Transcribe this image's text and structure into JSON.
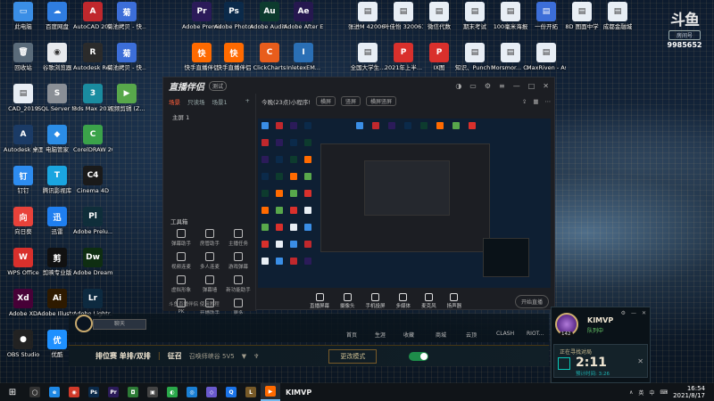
{
  "douyu": {
    "logo": "斗鱼",
    "room_label": "房间号",
    "room_number": "9985652"
  },
  "desktop_icons": [
    {
      "label": "此电脑",
      "color": "#3a8ee6",
      "glyph": "▭"
    },
    {
      "label": "百度网盘",
      "color": "#2f7de1",
      "glyph": "☁"
    },
    {
      "label": "AutoCAD 2019 - 简...",
      "color": "#c0282d",
      "glyph": "A"
    },
    {
      "label": "菊池拷贝 - 快...",
      "color": "#3c6ed8",
      "glyph": "菊"
    },
    {
      "label": "Adobe Premie...",
      "color": "#2b1b59",
      "glyph": "Pr"
    },
    {
      "label": "Adobe Photosh...",
      "color": "#0b2a4a",
      "glyph": "Ps"
    },
    {
      "label": "Adobe Auditi...",
      "color": "#0d3b2e",
      "glyph": "Au"
    },
    {
      "label": "Adobe After Effects CC",
      "color": "#26184f",
      "glyph": "Ae"
    },
    {
      "label": "回收站",
      "color": "#5a6b7a",
      "glyph": "🗑"
    },
    {
      "label": "谷歌浏览器",
      "color": "#e8eaed",
      "glyph": "◉"
    },
    {
      "label": "Autodesk ReCap",
      "color": "#2b2b2b",
      "glyph": "R"
    },
    {
      "label": "菊池拷贝 - 快...",
      "color": "#3c6ed8",
      "glyph": "菊"
    },
    {
      "label": "快手直播伴侣",
      "color": "#ff6a00",
      "glyph": "快"
    },
    {
      "label": "快手直播伴侣",
      "color": "#ff6a00",
      "glyph": "快"
    },
    {
      "label": "ClickCharts",
      "color": "#e85d1c",
      "glyph": "C"
    },
    {
      "label": "InletexEM...",
      "color": "#2a6fb5",
      "glyph": "I"
    },
    {
      "label": "CAD_2019",
      "color": "#e8eef5",
      "glyph": "▤"
    },
    {
      "label": "SQL Server Managem...",
      "color": "#8a8f96",
      "glyph": "S"
    },
    {
      "label": "3ds Max 2019",
      "color": "#1a8ca0",
      "glyph": "3"
    },
    {
      "label": "视频剪辑 (Z...",
      "color": "#58a84b",
      "glyph": "▶"
    },
    {
      "label": "Autodesk 桌面应用程序",
      "color": "#1b3b66",
      "glyph": "A"
    },
    {
      "label": "电脑管家",
      "color": "#2b8de6",
      "glyph": "◆"
    },
    {
      "label": "CorelDRAW 2020 (64-...",
      "color": "#3ba34a",
      "glyph": "C"
    },
    {
      "label": "钉钉",
      "color": "#2d8cf0",
      "glyph": "钉"
    },
    {
      "label": "腾讯影视库",
      "color": "#1aa5e0",
      "glyph": "T"
    },
    {
      "label": "Cinema 4D",
      "color": "#1a1a1a",
      "glyph": "C4"
    },
    {
      "label": "向日葵",
      "color": "#e9423a",
      "glyph": "向"
    },
    {
      "label": "迅雷",
      "color": "#1f7ff0",
      "glyph": "迅"
    },
    {
      "label": "Adobe Prelu...",
      "color": "#0f2e3a",
      "glyph": "Pl"
    },
    {
      "label": "WPS Office",
      "color": "#d9302c",
      "glyph": "W"
    },
    {
      "label": "剪映专业版",
      "color": "#111111",
      "glyph": "剪"
    },
    {
      "label": "Adobe Dreamwe...",
      "color": "#0f2e12",
      "glyph": "Dw"
    },
    {
      "label": "Adobe XD",
      "color": "#470137",
      "glyph": "Xd"
    },
    {
      "label": "Adobe Illustr...",
      "color": "#2e1a00",
      "glyph": "Ai"
    },
    {
      "label": "Adobe Lightr...",
      "color": "#0d2a40",
      "glyph": "Lr"
    },
    {
      "label": "OBS Studio",
      "color": "#222222",
      "glyph": "●"
    },
    {
      "label": "优酷",
      "color": "#1e90ff",
      "glyph": "优"
    },
    {
      "label": "张进M 42006017",
      "color": "#e8eef5",
      "glyph": "▤"
    },
    {
      "label": "叶佳怡 32006122",
      "color": "#e8eef5",
      "glyph": "▤"
    },
    {
      "label": "微信代数",
      "color": "#e8eef5",
      "glyph": "▤"
    },
    {
      "label": "期末考试",
      "color": "#e8eef5",
      "glyph": "▤"
    },
    {
      "label": "100毫米海报",
      "color": "#e8eef5",
      "glyph": "▤"
    },
    {
      "label": "一份开拓",
      "color": "#3c6ed8",
      "glyph": "▤"
    },
    {
      "label": "8D 图面中学",
      "color": "#e8eef5",
      "glyph": "▤"
    },
    {
      "label": "成都金融城",
      "color": "#e8eef5",
      "glyph": "▤"
    },
    {
      "label": "全国大学生...",
      "color": "#e8eef5",
      "glyph": "▤"
    },
    {
      "label": "2021年上半...",
      "color": "#d9302c",
      "glyph": "P"
    },
    {
      "label": "IX图",
      "color": "#d9302c",
      "glyph": "P"
    },
    {
      "label": "知识、Punch Home ...",
      "color": "#e8eef5",
      "glyph": "▤"
    },
    {
      "label": "Morsmor... Crazy D...",
      "color": "#e8eef5",
      "glyph": "▤"
    },
    {
      "label": "MaxRiven - Astronomi...",
      "color": "#e8eef5",
      "glyph": "▤"
    }
  ],
  "streaming_app": {
    "brand": "直播伴侣",
    "version": "测试",
    "scene_tabs": [
      "场景",
      "只读场",
      "场景1"
    ],
    "scene_item": "主屏 1",
    "toolbox_title": "工具箱",
    "tools": [
      "弹幕助手",
      "房管助手",
      "主播任务",
      "视频连麦",
      "多人连麦",
      "游戏弹幕",
      "虚拟形象",
      "弹幕墙",
      "新功能助手",
      "PK",
      "开播助手",
      "更多"
    ],
    "sidebar_footer": "斗鱼直播伴侣 使用教程",
    "preview_head_text": "今晚(23点)小程序!",
    "preview_pills": [
      "横屏",
      "竖屏",
      "横屏竖屏"
    ],
    "footer_tools": [
      "直播屏幕",
      "摄像头",
      "手机投屏",
      "多媒体",
      "麦克风",
      "扬声器"
    ],
    "start_button": "开始直播"
  },
  "lol": {
    "input_text": "聊天",
    "nav": [
      "首页",
      "生涯",
      "收藏",
      "商城",
      "云顶",
      "CLASH",
      "RIOT..."
    ],
    "mode": "排位赛 单排/双排",
    "separator": "|",
    "map": "征召",
    "sub": "召唤师峡谷 5V5",
    "change_mode": "更改模式",
    "panel": {
      "player_name": "KIMVP",
      "status": "队列中",
      "level": "142",
      "queue_label": "正在寻找对局",
      "queue_time": "2:11",
      "queue_est": "预计时间: 3:26"
    }
  },
  "taskbar": {
    "start": "⊞",
    "apps": [
      {
        "label": "◯",
        "color": "#333333"
      },
      {
        "label": "e",
        "color": "#1e88e5"
      },
      {
        "label": "◉",
        "color": "#d23a2a"
      },
      {
        "label": "Ps",
        "color": "#0b2a4a"
      },
      {
        "label": "Pr",
        "color": "#2b1b59"
      },
      {
        "label": "◘",
        "color": "#2d7b36"
      },
      {
        "label": "▣",
        "color": "#444444"
      },
      {
        "label": "◐",
        "color": "#2aa84a"
      },
      {
        "label": "◎",
        "color": "#1a7fd4"
      },
      {
        "label": "◇",
        "color": "#6a5acd"
      },
      {
        "label": "Q",
        "color": "#1a73e8"
      },
      {
        "label": "L",
        "color": "#785a28"
      },
      {
        "label": "▶",
        "color": "#ff6a00"
      }
    ],
    "tray": [
      "∧",
      "英",
      "中",
      "⌨"
    ],
    "time": "16:54",
    "date": "2021/8/17"
  },
  "overlay_text": "KIMVP"
}
